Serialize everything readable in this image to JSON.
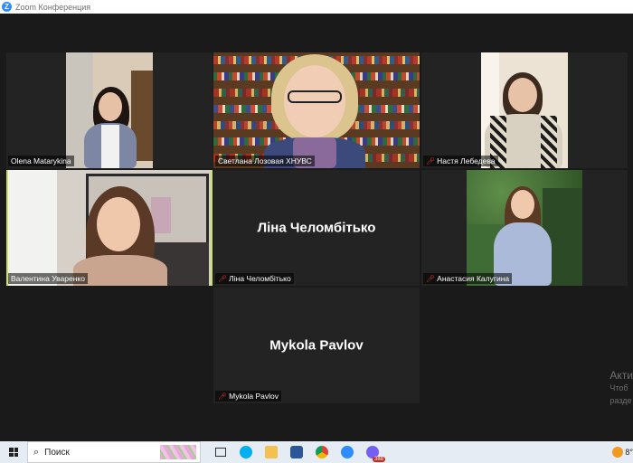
{
  "window": {
    "title": "Zoom Конференция",
    "logo_letter": "Z"
  },
  "participants": [
    {
      "name": "Olena Matarykina",
      "muted": false
    },
    {
      "name": "Светлана Лозовая ХНУВС",
      "muted": false
    },
    {
      "name": "Настя Лебедева",
      "muted": true
    },
    {
      "name": "Валентина Уваренко",
      "muted": false,
      "active_speaker": true
    },
    {
      "name": "Ліна Челомбітько",
      "muted": true,
      "video": false
    },
    {
      "name": "Анастасия Калугина",
      "muted": true
    },
    {
      "name": "Mykola Pavlov",
      "muted": true,
      "video": false
    }
  ],
  "watermark": {
    "line1": "Акти",
    "line2": "Чтоб",
    "line3": "разде"
  },
  "taskbar": {
    "search_placeholder": "Поиск",
    "apps": [
      "task-view",
      "skype",
      "file-explorer",
      "word",
      "chrome",
      "zoom",
      "viber"
    ],
    "viber_badge": "388",
    "tray_temp": "8°"
  },
  "colors": {
    "active_outline": "#c9e265",
    "zoom_blue": "#2d8cff",
    "muted_red": "#e0302c"
  }
}
